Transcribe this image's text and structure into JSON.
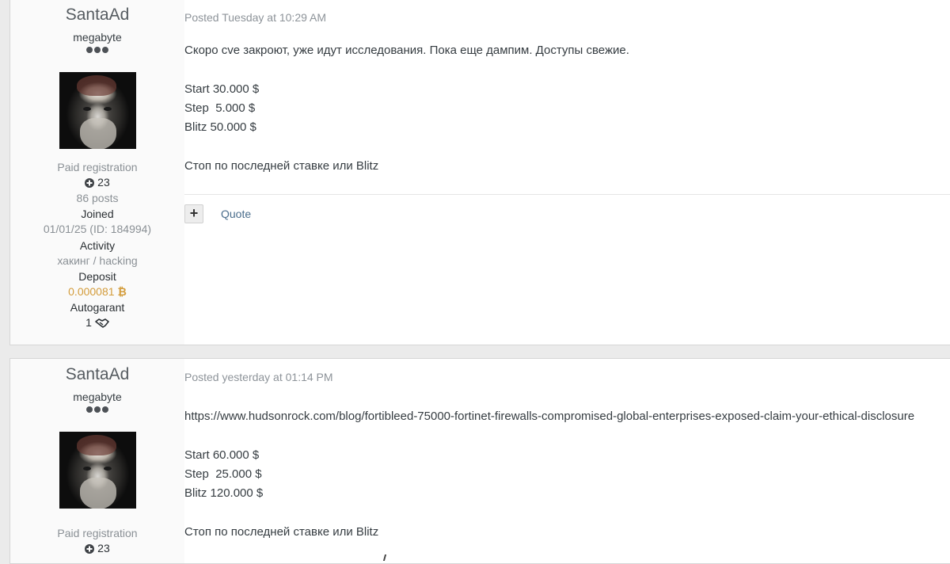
{
  "posts": [
    {
      "author": {
        "name": "SantaAd",
        "title": "megabyte",
        "registration": "Paid registration",
        "reputation": "23",
        "posts": "86 posts",
        "joined_label": "Joined",
        "joined_value": "01/01/25 (ID: 184994)",
        "activity_label": "Activity",
        "activity_value": "хакинг / hacking",
        "deposit_label": "Deposit",
        "deposit_value": "0.000081",
        "autogarant_label": "Autogarant",
        "autogarant_value": "1"
      },
      "posted": "Posted Tuesday at 10:29 AM",
      "lines": [
        "Скоро cve закроют, уже идут исследования. Пока еще дампим. Доступы свежие.",
        "Start 30.000 $",
        "Step  5.000 $",
        "Blitz 50.000 $",
        "Стоп по последней ставке или Blitz"
      ],
      "quote_label": "Quote"
    },
    {
      "author": {
        "name": "SantaAd",
        "title": "megabyte",
        "registration": "Paid registration",
        "reputation": "23"
      },
      "posted": "Posted yesterday at 01:14 PM",
      "lines": [
        "https://www.hudsonrock.com/blog/fortibleed-75000-fortinet-firewalls-compromised-global-enterprises-exposed-claim-your-ethical-disclosure",
        "Start 60.000 $",
        "Step  25.000 $",
        "Blitz 120.000 $",
        "Стоп по последней ставке или Blitz"
      ]
    }
  ],
  "colors": {
    "accent": "#4a6d8c",
    "deposit": "#d39c3b",
    "muted": "#8a9095"
  },
  "icons": [
    "plus-circle-icon",
    "bitcoin-icon",
    "handshake-icon",
    "plus-icon"
  ]
}
